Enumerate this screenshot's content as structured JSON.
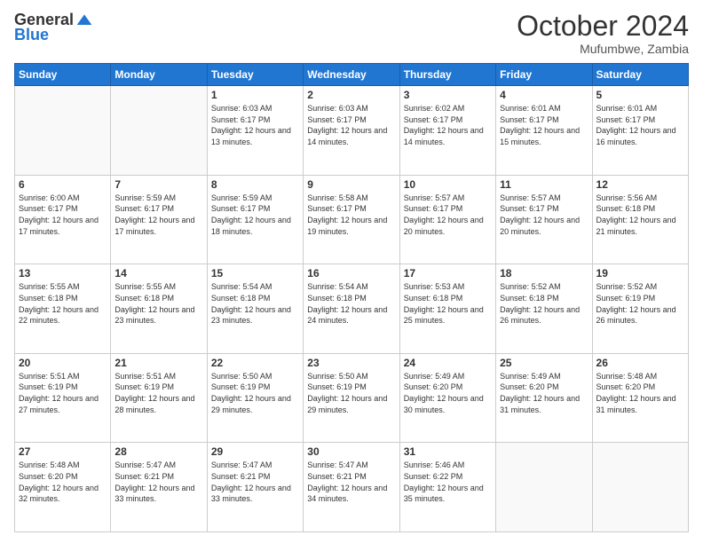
{
  "header": {
    "logo_general": "General",
    "logo_blue": "Blue",
    "month": "October 2024",
    "location": "Mufumbwe, Zambia"
  },
  "weekdays": [
    "Sunday",
    "Monday",
    "Tuesday",
    "Wednesday",
    "Thursday",
    "Friday",
    "Saturday"
  ],
  "weeks": [
    [
      {
        "day": "",
        "info": ""
      },
      {
        "day": "",
        "info": ""
      },
      {
        "day": "1",
        "info": "Sunrise: 6:03 AM\nSunset: 6:17 PM\nDaylight: 12 hours and 13 minutes."
      },
      {
        "day": "2",
        "info": "Sunrise: 6:03 AM\nSunset: 6:17 PM\nDaylight: 12 hours and 14 minutes."
      },
      {
        "day": "3",
        "info": "Sunrise: 6:02 AM\nSunset: 6:17 PM\nDaylight: 12 hours and 14 minutes."
      },
      {
        "day": "4",
        "info": "Sunrise: 6:01 AM\nSunset: 6:17 PM\nDaylight: 12 hours and 15 minutes."
      },
      {
        "day": "5",
        "info": "Sunrise: 6:01 AM\nSunset: 6:17 PM\nDaylight: 12 hours and 16 minutes."
      }
    ],
    [
      {
        "day": "6",
        "info": "Sunrise: 6:00 AM\nSunset: 6:17 PM\nDaylight: 12 hours and 17 minutes."
      },
      {
        "day": "7",
        "info": "Sunrise: 5:59 AM\nSunset: 6:17 PM\nDaylight: 12 hours and 17 minutes."
      },
      {
        "day": "8",
        "info": "Sunrise: 5:59 AM\nSunset: 6:17 PM\nDaylight: 12 hours and 18 minutes."
      },
      {
        "day": "9",
        "info": "Sunrise: 5:58 AM\nSunset: 6:17 PM\nDaylight: 12 hours and 19 minutes."
      },
      {
        "day": "10",
        "info": "Sunrise: 5:57 AM\nSunset: 6:17 PM\nDaylight: 12 hours and 20 minutes."
      },
      {
        "day": "11",
        "info": "Sunrise: 5:57 AM\nSunset: 6:17 PM\nDaylight: 12 hours and 20 minutes."
      },
      {
        "day": "12",
        "info": "Sunrise: 5:56 AM\nSunset: 6:18 PM\nDaylight: 12 hours and 21 minutes."
      }
    ],
    [
      {
        "day": "13",
        "info": "Sunrise: 5:55 AM\nSunset: 6:18 PM\nDaylight: 12 hours and 22 minutes."
      },
      {
        "day": "14",
        "info": "Sunrise: 5:55 AM\nSunset: 6:18 PM\nDaylight: 12 hours and 23 minutes."
      },
      {
        "day": "15",
        "info": "Sunrise: 5:54 AM\nSunset: 6:18 PM\nDaylight: 12 hours and 23 minutes."
      },
      {
        "day": "16",
        "info": "Sunrise: 5:54 AM\nSunset: 6:18 PM\nDaylight: 12 hours and 24 minutes."
      },
      {
        "day": "17",
        "info": "Sunrise: 5:53 AM\nSunset: 6:18 PM\nDaylight: 12 hours and 25 minutes."
      },
      {
        "day": "18",
        "info": "Sunrise: 5:52 AM\nSunset: 6:18 PM\nDaylight: 12 hours and 26 minutes."
      },
      {
        "day": "19",
        "info": "Sunrise: 5:52 AM\nSunset: 6:19 PM\nDaylight: 12 hours and 26 minutes."
      }
    ],
    [
      {
        "day": "20",
        "info": "Sunrise: 5:51 AM\nSunset: 6:19 PM\nDaylight: 12 hours and 27 minutes."
      },
      {
        "day": "21",
        "info": "Sunrise: 5:51 AM\nSunset: 6:19 PM\nDaylight: 12 hours and 28 minutes."
      },
      {
        "day": "22",
        "info": "Sunrise: 5:50 AM\nSunset: 6:19 PM\nDaylight: 12 hours and 29 minutes."
      },
      {
        "day": "23",
        "info": "Sunrise: 5:50 AM\nSunset: 6:19 PM\nDaylight: 12 hours and 29 minutes."
      },
      {
        "day": "24",
        "info": "Sunrise: 5:49 AM\nSunset: 6:20 PM\nDaylight: 12 hours and 30 minutes."
      },
      {
        "day": "25",
        "info": "Sunrise: 5:49 AM\nSunset: 6:20 PM\nDaylight: 12 hours and 31 minutes."
      },
      {
        "day": "26",
        "info": "Sunrise: 5:48 AM\nSunset: 6:20 PM\nDaylight: 12 hours and 31 minutes."
      }
    ],
    [
      {
        "day": "27",
        "info": "Sunrise: 5:48 AM\nSunset: 6:20 PM\nDaylight: 12 hours and 32 minutes."
      },
      {
        "day": "28",
        "info": "Sunrise: 5:47 AM\nSunset: 6:21 PM\nDaylight: 12 hours and 33 minutes."
      },
      {
        "day": "29",
        "info": "Sunrise: 5:47 AM\nSunset: 6:21 PM\nDaylight: 12 hours and 33 minutes."
      },
      {
        "day": "30",
        "info": "Sunrise: 5:47 AM\nSunset: 6:21 PM\nDaylight: 12 hours and 34 minutes."
      },
      {
        "day": "31",
        "info": "Sunrise: 5:46 AM\nSunset: 6:22 PM\nDaylight: 12 hours and 35 minutes."
      },
      {
        "day": "",
        "info": ""
      },
      {
        "day": "",
        "info": ""
      }
    ]
  ]
}
